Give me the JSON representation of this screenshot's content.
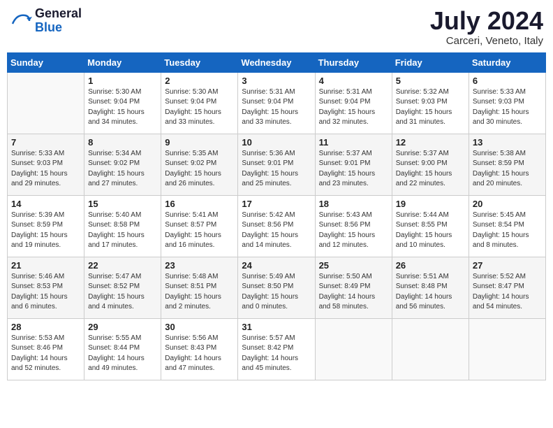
{
  "header": {
    "logo_general": "General",
    "logo_blue": "Blue",
    "month_year": "July 2024",
    "location": "Carceri, Veneto, Italy"
  },
  "days_of_week": [
    "Sunday",
    "Monday",
    "Tuesday",
    "Wednesday",
    "Thursday",
    "Friday",
    "Saturday"
  ],
  "weeks": [
    [
      {
        "num": "",
        "empty": true
      },
      {
        "num": "1",
        "sunrise": "5:30 AM",
        "sunset": "9:04 PM",
        "daylight": "15 hours and 34 minutes."
      },
      {
        "num": "2",
        "sunrise": "5:30 AM",
        "sunset": "9:04 PM",
        "daylight": "15 hours and 33 minutes."
      },
      {
        "num": "3",
        "sunrise": "5:31 AM",
        "sunset": "9:04 PM",
        "daylight": "15 hours and 33 minutes."
      },
      {
        "num": "4",
        "sunrise": "5:31 AM",
        "sunset": "9:04 PM",
        "daylight": "15 hours and 32 minutes."
      },
      {
        "num": "5",
        "sunrise": "5:32 AM",
        "sunset": "9:03 PM",
        "daylight": "15 hours and 31 minutes."
      },
      {
        "num": "6",
        "sunrise": "5:33 AM",
        "sunset": "9:03 PM",
        "daylight": "15 hours and 30 minutes."
      }
    ],
    [
      {
        "num": "7",
        "sunrise": "5:33 AM",
        "sunset": "9:03 PM",
        "daylight": "15 hours and 29 minutes."
      },
      {
        "num": "8",
        "sunrise": "5:34 AM",
        "sunset": "9:02 PM",
        "daylight": "15 hours and 27 minutes."
      },
      {
        "num": "9",
        "sunrise": "5:35 AM",
        "sunset": "9:02 PM",
        "daylight": "15 hours and 26 minutes."
      },
      {
        "num": "10",
        "sunrise": "5:36 AM",
        "sunset": "9:01 PM",
        "daylight": "15 hours and 25 minutes."
      },
      {
        "num": "11",
        "sunrise": "5:37 AM",
        "sunset": "9:01 PM",
        "daylight": "15 hours and 23 minutes."
      },
      {
        "num": "12",
        "sunrise": "5:37 AM",
        "sunset": "9:00 PM",
        "daylight": "15 hours and 22 minutes."
      },
      {
        "num": "13",
        "sunrise": "5:38 AM",
        "sunset": "8:59 PM",
        "daylight": "15 hours and 20 minutes."
      }
    ],
    [
      {
        "num": "14",
        "sunrise": "5:39 AM",
        "sunset": "8:59 PM",
        "daylight": "15 hours and 19 minutes."
      },
      {
        "num": "15",
        "sunrise": "5:40 AM",
        "sunset": "8:58 PM",
        "daylight": "15 hours and 17 minutes."
      },
      {
        "num": "16",
        "sunrise": "5:41 AM",
        "sunset": "8:57 PM",
        "daylight": "15 hours and 16 minutes."
      },
      {
        "num": "17",
        "sunrise": "5:42 AM",
        "sunset": "8:56 PM",
        "daylight": "15 hours and 14 minutes."
      },
      {
        "num": "18",
        "sunrise": "5:43 AM",
        "sunset": "8:56 PM",
        "daylight": "15 hours and 12 minutes."
      },
      {
        "num": "19",
        "sunrise": "5:44 AM",
        "sunset": "8:55 PM",
        "daylight": "15 hours and 10 minutes."
      },
      {
        "num": "20",
        "sunrise": "5:45 AM",
        "sunset": "8:54 PM",
        "daylight": "15 hours and 8 minutes."
      }
    ],
    [
      {
        "num": "21",
        "sunrise": "5:46 AM",
        "sunset": "8:53 PM",
        "daylight": "15 hours and 6 minutes."
      },
      {
        "num": "22",
        "sunrise": "5:47 AM",
        "sunset": "8:52 PM",
        "daylight": "15 hours and 4 minutes."
      },
      {
        "num": "23",
        "sunrise": "5:48 AM",
        "sunset": "8:51 PM",
        "daylight": "15 hours and 2 minutes."
      },
      {
        "num": "24",
        "sunrise": "5:49 AM",
        "sunset": "8:50 PM",
        "daylight": "15 hours and 0 minutes."
      },
      {
        "num": "25",
        "sunrise": "5:50 AM",
        "sunset": "8:49 PM",
        "daylight": "14 hours and 58 minutes."
      },
      {
        "num": "26",
        "sunrise": "5:51 AM",
        "sunset": "8:48 PM",
        "daylight": "14 hours and 56 minutes."
      },
      {
        "num": "27",
        "sunrise": "5:52 AM",
        "sunset": "8:47 PM",
        "daylight": "14 hours and 54 minutes."
      }
    ],
    [
      {
        "num": "28",
        "sunrise": "5:53 AM",
        "sunset": "8:46 PM",
        "daylight": "14 hours and 52 minutes."
      },
      {
        "num": "29",
        "sunrise": "5:55 AM",
        "sunset": "8:44 PM",
        "daylight": "14 hours and 49 minutes."
      },
      {
        "num": "30",
        "sunrise": "5:56 AM",
        "sunset": "8:43 PM",
        "daylight": "14 hours and 47 minutes."
      },
      {
        "num": "31",
        "sunrise": "5:57 AM",
        "sunset": "8:42 PM",
        "daylight": "14 hours and 45 minutes."
      },
      {
        "num": "",
        "empty": true
      },
      {
        "num": "",
        "empty": true
      },
      {
        "num": "",
        "empty": true
      }
    ]
  ]
}
